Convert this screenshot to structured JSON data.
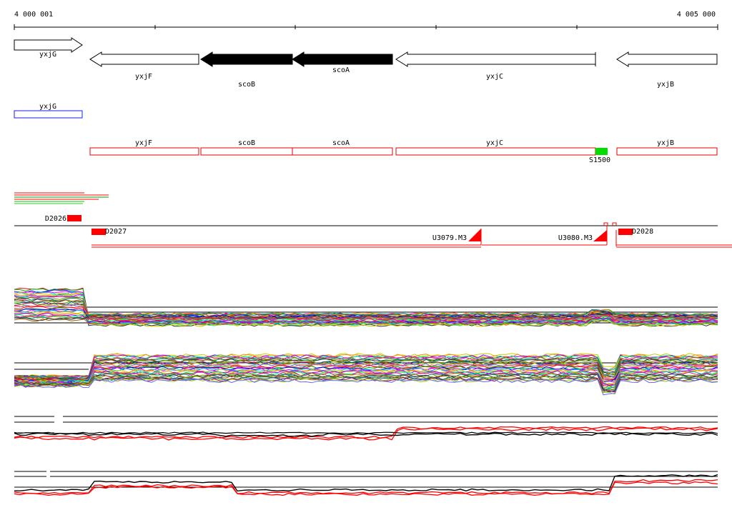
{
  "ruler": {
    "start_label": "4 000 001",
    "end_label": "4 005 000"
  },
  "genes": [
    {
      "name": "yxjG",
      "strand": "+",
      "filled": false
    },
    {
      "name": "yxjF",
      "strand": "-",
      "filled": false
    },
    {
      "name": "scoB",
      "strand": "-",
      "filled": true
    },
    {
      "name": "scoA",
      "strand": "-",
      "filled": true
    },
    {
      "name": "yxjC",
      "strand": "-",
      "filled": false
    },
    {
      "name": "yxjB",
      "strand": "-",
      "filled": false
    }
  ],
  "feature_boxes": [
    {
      "name": "yxjG",
      "color": "#1a1aff"
    },
    {
      "name": "yxjF",
      "color": "#e60000"
    },
    {
      "name": "scoB",
      "color": "#e60000"
    },
    {
      "name": "scoA",
      "color": "#e60000"
    },
    {
      "name": "yxjC",
      "color": "#e60000"
    },
    {
      "name": "yxjB",
      "color": "#e60000"
    }
  ],
  "marker": {
    "name": "S1500",
    "color": "#00dd00"
  },
  "segments": [
    {
      "name": "D2026"
    },
    {
      "name": "D2027"
    },
    {
      "name": "U3079.M3"
    },
    {
      "name": "U3080.M3"
    },
    {
      "name": "D2028"
    }
  ],
  "colors": {
    "red": "#ff0000",
    "black": "#000000"
  }
}
